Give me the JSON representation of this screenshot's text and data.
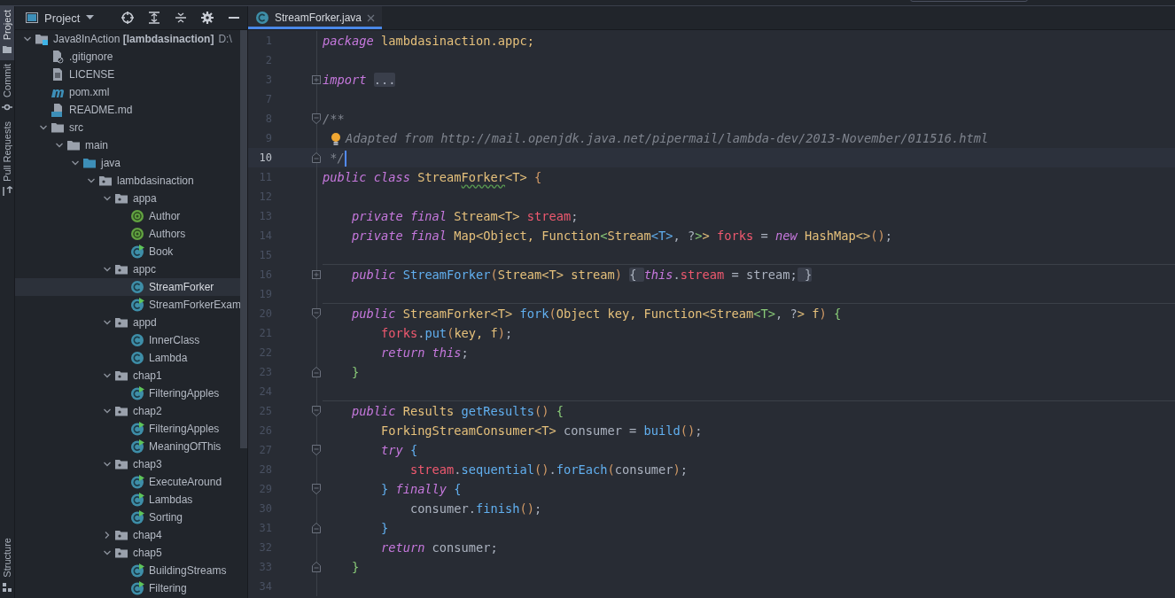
{
  "tool_strip": {
    "top": [
      {
        "label": "Project",
        "kind": "folder",
        "selected": true
      },
      {
        "label": "Commit",
        "kind": "commit",
        "selected": false
      },
      {
        "label": "Pull Requests",
        "kind": "pull",
        "selected": false
      }
    ],
    "bottom": [
      {
        "label": "Structure",
        "kind": "structure",
        "selected": false
      }
    ]
  },
  "project_panel": {
    "title": "Project",
    "tree": [
      {
        "label": "Java8InAction **[lambdasinaction]**",
        "path": "D:\\",
        "kind": "module",
        "selected": false,
        "expanded": true,
        "children": [
          {
            "label": ".gitignore",
            "kind": "gitignore",
            "selected": false
          },
          {
            "label": "LICENSE",
            "kind": "text",
            "selected": false
          },
          {
            "label": "pom.xml",
            "kind": "maven",
            "selected": false
          },
          {
            "label": "README.md",
            "kind": "markdown",
            "selected": false
          },
          {
            "label": "src",
            "kind": "folder",
            "selected": false,
            "expanded": true,
            "children": [
              {
                "label": "main",
                "kind": "folder",
                "selected": false,
                "expanded": true,
                "children": [
                  {
                    "label": "java",
                    "kind": "source",
                    "selected": false,
                    "expanded": true,
                    "children": [
                      {
                        "label": "lambdasinaction",
                        "kind": "package",
                        "selected": false,
                        "expanded": true,
                        "children": [
                          {
                            "label": "appa",
                            "kind": "package",
                            "selected": false,
                            "expanded": true,
                            "children": [
                              {
                                "label": "Author",
                                "kind": "annotation",
                                "selected": false
                              },
                              {
                                "label": "Authors",
                                "kind": "annotation",
                                "selected": false
                              },
                              {
                                "label": "Book",
                                "kind": "runnable",
                                "selected": false
                              }
                            ]
                          },
                          {
                            "label": "appc",
                            "kind": "package",
                            "selected": false,
                            "expanded": true,
                            "children": [
                              {
                                "label": "StreamForker",
                                "kind": "class",
                                "selected": true
                              },
                              {
                                "label": "StreamForkerExam",
                                "kind": "runnable",
                                "selected": false
                              }
                            ]
                          },
                          {
                            "label": "appd",
                            "kind": "package",
                            "selected": false,
                            "expanded": true,
                            "children": [
                              {
                                "label": "InnerClass",
                                "kind": "class",
                                "selected": false
                              },
                              {
                                "label": "Lambda",
                                "kind": "class",
                                "selected": false
                              }
                            ]
                          },
                          {
                            "label": "chap1",
                            "kind": "package",
                            "selected": false,
                            "expanded": true,
                            "children": [
                              {
                                "label": "FilteringApples",
                                "kind": "runnable",
                                "selected": false
                              }
                            ]
                          },
                          {
                            "label": "chap2",
                            "kind": "package",
                            "selected": false,
                            "expanded": true,
                            "children": [
                              {
                                "label": "FilteringApples",
                                "kind": "runnable",
                                "selected": false
                              },
                              {
                                "label": "MeaningOfThis",
                                "kind": "runnable",
                                "selected": false
                              }
                            ]
                          },
                          {
                            "label": "chap3",
                            "kind": "package",
                            "selected": false,
                            "expanded": true,
                            "children": [
                              {
                                "label": "ExecuteAround",
                                "kind": "runnable",
                                "selected": false
                              },
                              {
                                "label": "Lambdas",
                                "kind": "runnable",
                                "selected": false
                              },
                              {
                                "label": "Sorting",
                                "kind": "runnable",
                                "selected": false
                              }
                            ]
                          },
                          {
                            "label": "chap4",
                            "kind": "package",
                            "selected": false,
                            "expanded": false
                          },
                          {
                            "label": "chap5",
                            "kind": "package",
                            "selected": false,
                            "expanded": true,
                            "children": [
                              {
                                "label": "BuildingStreams",
                                "kind": "runnable",
                                "selected": false
                              },
                              {
                                "label": "Filtering",
                                "kind": "runnable",
                                "selected": false
                              }
                            ]
                          }
                        ]
                      }
                    ]
                  }
                ]
              }
            ]
          }
        ]
      }
    ]
  },
  "editor": {
    "tabs": [
      {
        "label": "StreamForker.java",
        "selected": true
      }
    ],
    "lines": [
      {
        "number": "1",
        "current": false,
        "separator": false,
        "tokens": [
          {
            "kind": "kw",
            "text": "package"
          },
          {
            "kind": "type",
            "text": " lambdasinaction.appc;"
          }
        ]
      },
      {
        "number": "2",
        "current": false,
        "separator": false
      },
      {
        "number": "3",
        "current": false,
        "separator": false,
        "fold": {
          "kind": "collapsed"
        },
        "tokens": [
          {
            "kind": "kw",
            "text": "import "
          },
          {
            "kind": "folded",
            "text": "..."
          }
        ]
      },
      {
        "number": "7",
        "current": false,
        "separator": false
      },
      {
        "number": "8",
        "current": false,
        "separator": false,
        "fold": {
          "kind": "start"
        },
        "tokens": [
          {
            "kind": "comment",
            "text": "/**"
          }
        ]
      },
      {
        "number": "9",
        "current": false,
        "separator": false,
        "marker": {
          "kind": "bulb"
        },
        "tokens": [
          {
            "kind": "comment",
            "text": "Adapted from http://mail.openjdk.java.net/pipermail/lambda-dev/2013-November/011516.html"
          }
        ]
      },
      {
        "number": "10",
        "current": true,
        "separator": false,
        "fold": {
          "kind": "end"
        },
        "tokens": [
          {
            "kind": "comment",
            "text": " */"
          }
        ]
      },
      {
        "number": "11",
        "current": false,
        "separator": false,
        "tokens": [
          {
            "kind": "kw",
            "text": "public class "
          },
          {
            "kind": "type",
            "text": "Stream"
          },
          {
            "kind": "typo",
            "text": "Forker"
          },
          {
            "kind": "type",
            "text": "<T> "
          },
          {
            "kind": "paren",
            "text": "{"
          }
        ]
      },
      {
        "number": "12",
        "current": false,
        "separator": false
      },
      {
        "number": "13",
        "current": false,
        "separator": false,
        "tokens": [
          {
            "kind": "kw",
            "text": "    private final "
          },
          {
            "kind": "type",
            "text": "Stream<T> "
          },
          {
            "kind": "field",
            "text": "stream"
          },
          {
            "kind": "plain",
            "text": ";"
          }
        ]
      },
      {
        "number": "14",
        "current": false,
        "separator": false,
        "tokens": [
          {
            "kind": "kw",
            "text": "    private final "
          },
          {
            "kind": "type",
            "text": "Map<Object, Function"
          },
          {
            "kind": "brace",
            "text": "<"
          },
          {
            "kind": "type",
            "text": "Stream"
          },
          {
            "kind": "generic",
            "text": "<T>"
          },
          {
            "kind": "plain",
            "text": ", ?"
          },
          {
            "kind": "brace",
            "text": ">"
          },
          {
            "kind": "type",
            "text": "> "
          },
          {
            "kind": "field",
            "text": "forks"
          },
          {
            "kind": "plain",
            "text": " = "
          },
          {
            "kind": "kw",
            "text": "new "
          },
          {
            "kind": "type",
            "text": "HashMap<>"
          },
          {
            "kind": "paren",
            "text": "()"
          },
          {
            "kind": "plain",
            "text": ";"
          }
        ]
      },
      {
        "number": "15",
        "current": false,
        "separator": false
      },
      {
        "number": "16",
        "current": false,
        "separator": true,
        "fold": {
          "kind": "collapsed"
        },
        "tokens": [
          {
            "kind": "kw",
            "text": "    public "
          },
          {
            "kind": "fn",
            "text": "StreamForker"
          },
          {
            "kind": "paren",
            "text": "("
          },
          {
            "kind": "type",
            "text": "Stream<T> stream"
          },
          {
            "kind": "paren",
            "text": ") "
          },
          {
            "kind": "folded",
            "text": "{ "
          },
          {
            "kind": "kw",
            "text": "this"
          },
          {
            "kind": "plain",
            "text": "."
          },
          {
            "kind": "field",
            "text": "stream"
          },
          {
            "kind": "plain",
            "text": " = stream;"
          },
          {
            "kind": "folded",
            "text": " }"
          }
        ]
      },
      {
        "number": "19",
        "current": false,
        "separator": false
      },
      {
        "number": "20",
        "current": false,
        "separator": true,
        "fold": {
          "kind": "start"
        },
        "tokens": [
          {
            "kind": "kw",
            "text": "    public "
          },
          {
            "kind": "type",
            "text": "StreamForker<T> "
          },
          {
            "kind": "fn",
            "text": "fork"
          },
          {
            "kind": "paren",
            "text": "("
          },
          {
            "kind": "type",
            "text": "Object key, Function<Stream"
          },
          {
            "kind": "brace",
            "text": "<T>"
          },
          {
            "kind": "plain",
            "text": ", ?"
          },
          {
            "kind": "type",
            "text": "> f"
          },
          {
            "kind": "paren",
            "text": ") "
          },
          {
            "kind": "brace",
            "text": "{"
          }
        ]
      },
      {
        "number": "21",
        "current": false,
        "separator": false,
        "tokens": [
          {
            "kind": "field",
            "text": "        forks"
          },
          {
            "kind": "plain",
            "text": "."
          },
          {
            "kind": "fn",
            "text": "put"
          },
          {
            "kind": "paren",
            "text": "("
          },
          {
            "kind": "type",
            "text": "key, f"
          },
          {
            "kind": "paren",
            "text": ")"
          },
          {
            "kind": "plain",
            "text": ";"
          }
        ]
      },
      {
        "number": "22",
        "current": false,
        "separator": false,
        "tokens": [
          {
            "kind": "kw",
            "text": "        return this"
          },
          {
            "kind": "plain",
            "text": ";"
          }
        ]
      },
      {
        "number": "23",
        "current": false,
        "separator": false,
        "fold": {
          "kind": "end"
        },
        "tokens": [
          {
            "kind": "brace",
            "text": "    }"
          }
        ]
      },
      {
        "number": "24",
        "current": false,
        "separator": false
      },
      {
        "number": "25",
        "current": false,
        "separator": true,
        "fold": {
          "kind": "start"
        },
        "tokens": [
          {
            "kind": "kw",
            "text": "    public "
          },
          {
            "kind": "type",
            "text": "Results "
          },
          {
            "kind": "fn",
            "text": "getResults"
          },
          {
            "kind": "paren",
            "text": "() "
          },
          {
            "kind": "brace",
            "text": "{"
          }
        ]
      },
      {
        "number": "26",
        "current": false,
        "separator": false,
        "tokens": [
          {
            "kind": "type",
            "text": "        ForkingStreamConsumer<T> "
          },
          {
            "kind": "plain",
            "text": "consumer = "
          },
          {
            "kind": "fn",
            "text": "build"
          },
          {
            "kind": "paren",
            "text": "()"
          },
          {
            "kind": "plain",
            "text": ";"
          }
        ]
      },
      {
        "number": "27",
        "current": false,
        "separator": false,
        "fold": {
          "kind": "start"
        },
        "tokens": [
          {
            "kind": "kw",
            "text": "        try "
          },
          {
            "kind": "brace2",
            "text": "{"
          }
        ]
      },
      {
        "number": "28",
        "current": false,
        "separator": false,
        "tokens": [
          {
            "kind": "field",
            "text": "            stream"
          },
          {
            "kind": "plain",
            "text": "."
          },
          {
            "kind": "fn",
            "text": "sequential"
          },
          {
            "kind": "paren",
            "text": "()"
          },
          {
            "kind": "plain",
            "text": "."
          },
          {
            "kind": "fn",
            "text": "forEach"
          },
          {
            "kind": "paren",
            "text": "("
          },
          {
            "kind": "plain",
            "text": "consumer"
          },
          {
            "kind": "paren",
            "text": ")"
          },
          {
            "kind": "plain",
            "text": ";"
          }
        ]
      },
      {
        "number": "29",
        "current": false,
        "separator": false,
        "fold": {
          "kind": "start"
        },
        "tokens": [
          {
            "kind": "brace2",
            "text": "        } "
          },
          {
            "kind": "kw",
            "text": "finally "
          },
          {
            "kind": "brace2",
            "text": "{"
          }
        ]
      },
      {
        "number": "30",
        "current": false,
        "separator": false,
        "tokens": [
          {
            "kind": "plain",
            "text": "            consumer."
          },
          {
            "kind": "fn",
            "text": "finish"
          },
          {
            "kind": "paren",
            "text": "()"
          },
          {
            "kind": "plain",
            "text": ";"
          }
        ]
      },
      {
        "number": "31",
        "current": false,
        "separator": false,
        "fold": {
          "kind": "end"
        },
        "tokens": [
          {
            "kind": "brace2",
            "text": "        }"
          }
        ]
      },
      {
        "number": "32",
        "current": false,
        "separator": false,
        "tokens": [
          {
            "kind": "kw",
            "text": "        return "
          },
          {
            "kind": "plain",
            "text": "consumer;"
          }
        ]
      },
      {
        "number": "33",
        "current": false,
        "separator": false,
        "fold": {
          "kind": "end"
        },
        "tokens": [
          {
            "kind": "brace",
            "text": "    }"
          }
        ]
      },
      {
        "number": "34",
        "current": false,
        "separator": false
      }
    ]
  }
}
